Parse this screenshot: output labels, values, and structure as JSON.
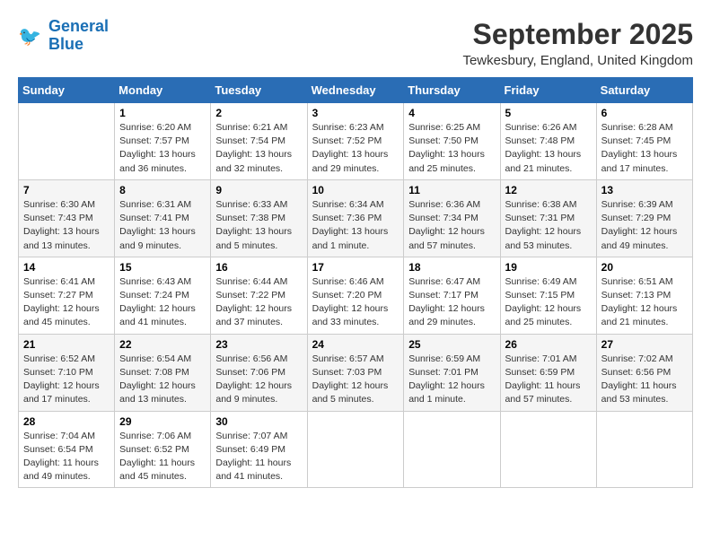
{
  "logo": {
    "line1": "General",
    "line2": "Blue"
  },
  "title": "September 2025",
  "location": "Tewkesbury, England, United Kingdom",
  "days_header": [
    "Sunday",
    "Monday",
    "Tuesday",
    "Wednesday",
    "Thursday",
    "Friday",
    "Saturday"
  ],
  "weeks": [
    [
      {
        "day": "",
        "info": ""
      },
      {
        "day": "1",
        "info": "Sunrise: 6:20 AM\nSunset: 7:57 PM\nDaylight: 13 hours\nand 36 minutes."
      },
      {
        "day": "2",
        "info": "Sunrise: 6:21 AM\nSunset: 7:54 PM\nDaylight: 13 hours\nand 32 minutes."
      },
      {
        "day": "3",
        "info": "Sunrise: 6:23 AM\nSunset: 7:52 PM\nDaylight: 13 hours\nand 29 minutes."
      },
      {
        "day": "4",
        "info": "Sunrise: 6:25 AM\nSunset: 7:50 PM\nDaylight: 13 hours\nand 25 minutes."
      },
      {
        "day": "5",
        "info": "Sunrise: 6:26 AM\nSunset: 7:48 PM\nDaylight: 13 hours\nand 21 minutes."
      },
      {
        "day": "6",
        "info": "Sunrise: 6:28 AM\nSunset: 7:45 PM\nDaylight: 13 hours\nand 17 minutes."
      }
    ],
    [
      {
        "day": "7",
        "info": "Sunrise: 6:30 AM\nSunset: 7:43 PM\nDaylight: 13 hours\nand 13 minutes."
      },
      {
        "day": "8",
        "info": "Sunrise: 6:31 AM\nSunset: 7:41 PM\nDaylight: 13 hours\nand 9 minutes."
      },
      {
        "day": "9",
        "info": "Sunrise: 6:33 AM\nSunset: 7:38 PM\nDaylight: 13 hours\nand 5 minutes."
      },
      {
        "day": "10",
        "info": "Sunrise: 6:34 AM\nSunset: 7:36 PM\nDaylight: 13 hours\nand 1 minute."
      },
      {
        "day": "11",
        "info": "Sunrise: 6:36 AM\nSunset: 7:34 PM\nDaylight: 12 hours\nand 57 minutes."
      },
      {
        "day": "12",
        "info": "Sunrise: 6:38 AM\nSunset: 7:31 PM\nDaylight: 12 hours\nand 53 minutes."
      },
      {
        "day": "13",
        "info": "Sunrise: 6:39 AM\nSunset: 7:29 PM\nDaylight: 12 hours\nand 49 minutes."
      }
    ],
    [
      {
        "day": "14",
        "info": "Sunrise: 6:41 AM\nSunset: 7:27 PM\nDaylight: 12 hours\nand 45 minutes."
      },
      {
        "day": "15",
        "info": "Sunrise: 6:43 AM\nSunset: 7:24 PM\nDaylight: 12 hours\nand 41 minutes."
      },
      {
        "day": "16",
        "info": "Sunrise: 6:44 AM\nSunset: 7:22 PM\nDaylight: 12 hours\nand 37 minutes."
      },
      {
        "day": "17",
        "info": "Sunrise: 6:46 AM\nSunset: 7:20 PM\nDaylight: 12 hours\nand 33 minutes."
      },
      {
        "day": "18",
        "info": "Sunrise: 6:47 AM\nSunset: 7:17 PM\nDaylight: 12 hours\nand 29 minutes."
      },
      {
        "day": "19",
        "info": "Sunrise: 6:49 AM\nSunset: 7:15 PM\nDaylight: 12 hours\nand 25 minutes."
      },
      {
        "day": "20",
        "info": "Sunrise: 6:51 AM\nSunset: 7:13 PM\nDaylight: 12 hours\nand 21 minutes."
      }
    ],
    [
      {
        "day": "21",
        "info": "Sunrise: 6:52 AM\nSunset: 7:10 PM\nDaylight: 12 hours\nand 17 minutes."
      },
      {
        "day": "22",
        "info": "Sunrise: 6:54 AM\nSunset: 7:08 PM\nDaylight: 12 hours\nand 13 minutes."
      },
      {
        "day": "23",
        "info": "Sunrise: 6:56 AM\nSunset: 7:06 PM\nDaylight: 12 hours\nand 9 minutes."
      },
      {
        "day": "24",
        "info": "Sunrise: 6:57 AM\nSunset: 7:03 PM\nDaylight: 12 hours\nand 5 minutes."
      },
      {
        "day": "25",
        "info": "Sunrise: 6:59 AM\nSunset: 7:01 PM\nDaylight: 12 hours\nand 1 minute."
      },
      {
        "day": "26",
        "info": "Sunrise: 7:01 AM\nSunset: 6:59 PM\nDaylight: 11 hours\nand 57 minutes."
      },
      {
        "day": "27",
        "info": "Sunrise: 7:02 AM\nSunset: 6:56 PM\nDaylight: 11 hours\nand 53 minutes."
      }
    ],
    [
      {
        "day": "28",
        "info": "Sunrise: 7:04 AM\nSunset: 6:54 PM\nDaylight: 11 hours\nand 49 minutes."
      },
      {
        "day": "29",
        "info": "Sunrise: 7:06 AM\nSunset: 6:52 PM\nDaylight: 11 hours\nand 45 minutes."
      },
      {
        "day": "30",
        "info": "Sunrise: 7:07 AM\nSunset: 6:49 PM\nDaylight: 11 hours\nand 41 minutes."
      },
      {
        "day": "",
        "info": ""
      },
      {
        "day": "",
        "info": ""
      },
      {
        "day": "",
        "info": ""
      },
      {
        "day": "",
        "info": ""
      }
    ]
  ]
}
